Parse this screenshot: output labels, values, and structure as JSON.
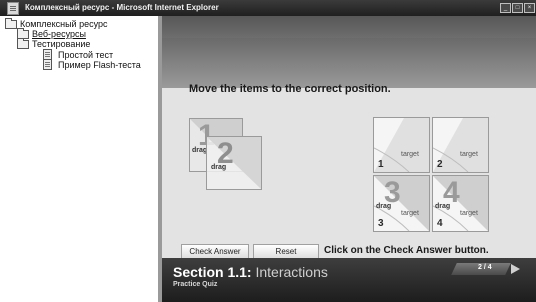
{
  "window": {
    "title": "Комплексный ресурс - Microsoft Internet Explorer",
    "buttons": [
      "_",
      "□",
      "×"
    ]
  },
  "tree": {
    "items": [
      {
        "label": "Комплексный ресурс",
        "icon": "folder-icon"
      },
      {
        "label": "Веб-ресурсы",
        "icon": "folder-icon"
      },
      {
        "label": "Тестирование",
        "icon": "folder-icon"
      },
      {
        "label": "Простой тест",
        "icon": "document-icon"
      },
      {
        "label": "Пример Flash-теста",
        "icon": "document-icon"
      }
    ]
  },
  "quiz": {
    "question": "Move the items to the correct position.",
    "drag_items": [
      {
        "number": "1",
        "label": "drag"
      },
      {
        "number": "2",
        "label": "drag"
      }
    ],
    "targets": [
      {
        "number": "1",
        "label": "target",
        "filled": false
      },
      {
        "number": "2",
        "label": "target",
        "filled": false
      },
      {
        "number": "3",
        "label": "target",
        "filled": true,
        "drag_number": "3",
        "drag_label": "drag"
      },
      {
        "number": "4",
        "label": "target",
        "filled": true,
        "drag_number": "4",
        "drag_label": "drag"
      }
    ],
    "buttons": {
      "check": "Check Answer",
      "reset": "Reset"
    },
    "hint": "Click on the Check Answer button.",
    "section_title": "Section 1.1:",
    "section_name": "Interactions",
    "section_sub": "Practice Quiz",
    "page": "2 / 4"
  },
  "colors": {
    "footer": "#2a2a2a",
    "body": "#e3e3e3"
  }
}
